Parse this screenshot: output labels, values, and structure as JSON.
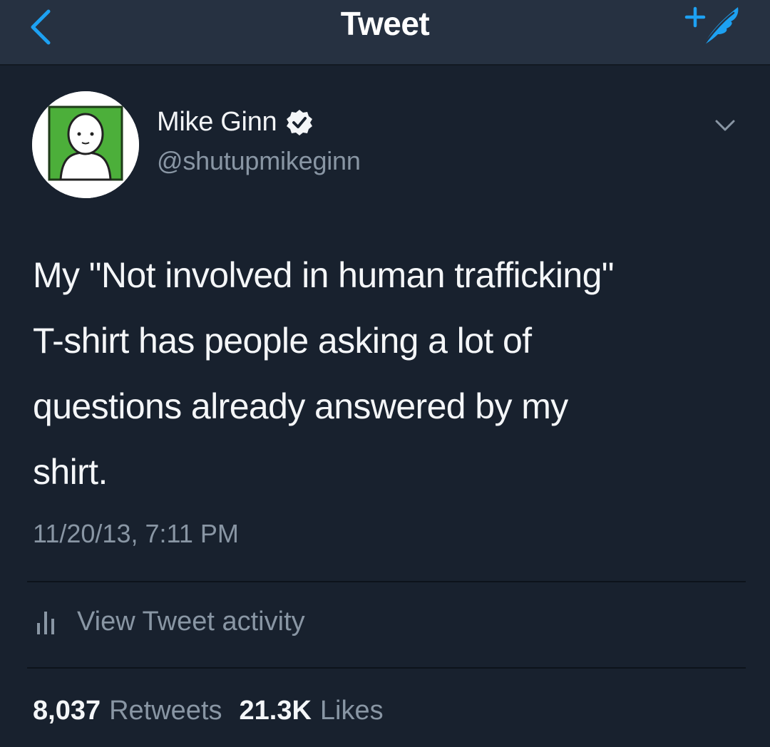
{
  "nav": {
    "title": "Tweet",
    "back_icon": "chevron-left-icon",
    "compose_icon": "compose-tweet-icon",
    "accent_color": "#1da1f2"
  },
  "tweet": {
    "author_name": "Mike Ginn",
    "author_handle": "@shutupmikeginn",
    "verified": true,
    "text_lines": [
      "My \"Not involved in human trafficking\"",
      "T-shirt has people asking a lot of",
      "questions already answered by my",
      "shirt."
    ],
    "timestamp": "11/20/13, 7:11 PM",
    "activity_label": "View Tweet activity",
    "retweets": {
      "count": "8,037",
      "label": "Retweets"
    },
    "likes": {
      "count": "21.3K",
      "label": "Likes"
    }
  },
  "colors": {
    "background": "#18212e",
    "navbar": "#263141",
    "secondary_text": "#8996a4",
    "avatar_green": "#4caf3a"
  }
}
